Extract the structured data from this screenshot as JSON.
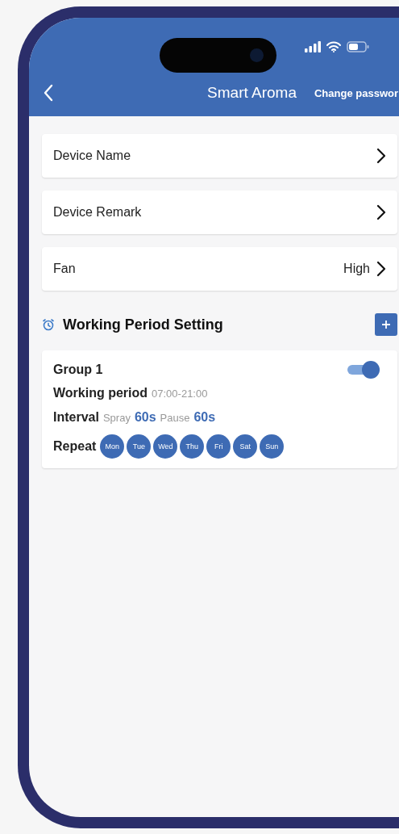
{
  "header": {
    "title": "Smart Aroma",
    "action": "Change passwor"
  },
  "settings": [
    {
      "label": "Device Name"
    },
    {
      "label": "Device Remark"
    },
    {
      "label": "Fan",
      "value": "High"
    }
  ],
  "working_period": {
    "title": "Working Period Setting",
    "groups": [
      {
        "name": "Group 1",
        "on": true,
        "period_label": "Working period",
        "period": "07:00-21:00",
        "interval_label": "Interval",
        "spray_label": "Spray",
        "spray": "60s",
        "pause_label": "Pause",
        "pause": "60s",
        "repeat_label": "Repeat",
        "days": [
          {
            "label": "Mon",
            "selected": true
          },
          {
            "label": "Tue",
            "selected": true
          },
          {
            "label": "Wed",
            "selected": true
          },
          {
            "label": "Thu",
            "selected": true
          },
          {
            "label": "Fri",
            "selected": true
          },
          {
            "label": "Sat",
            "selected": true
          },
          {
            "label": "Sun",
            "selected": true
          }
        ]
      }
    ]
  }
}
